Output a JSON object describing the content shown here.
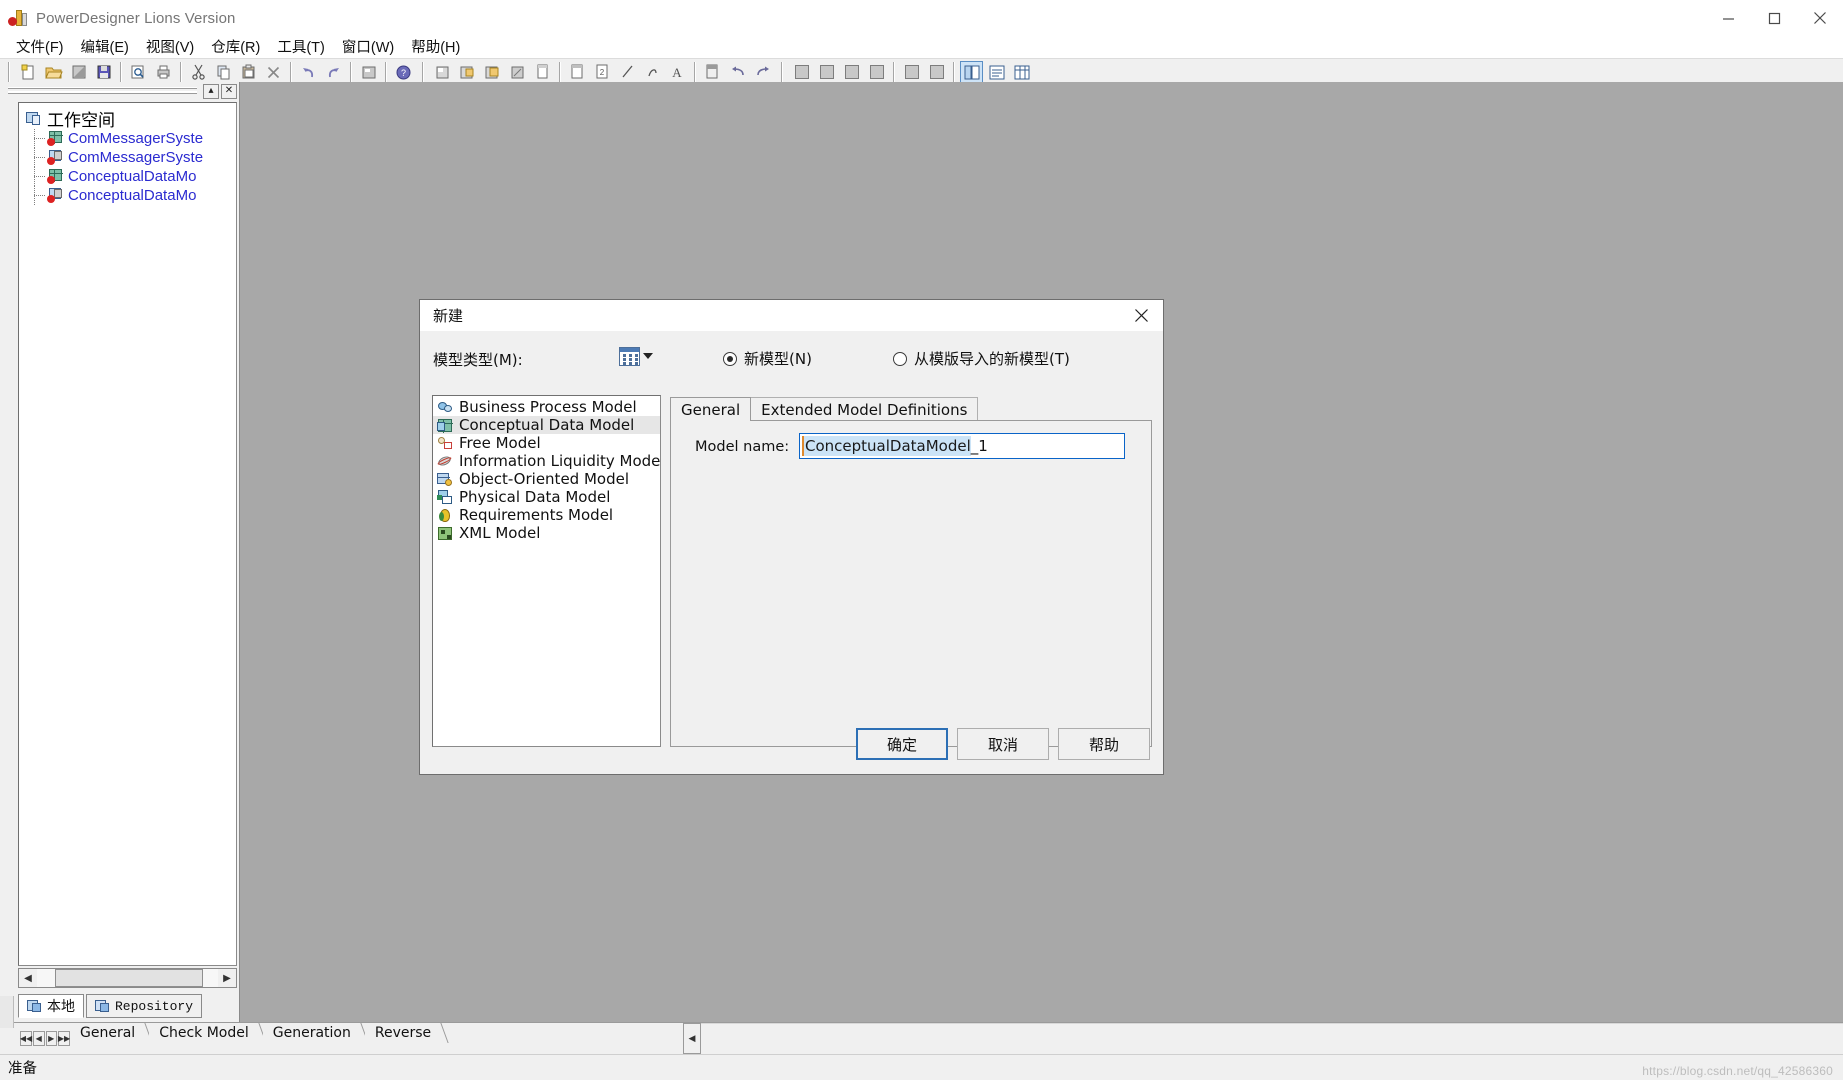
{
  "window": {
    "title": "PowerDesigner Lions Version",
    "app_icon": "powerdesigner-icon",
    "controls": {
      "minimize": "minimize-icon",
      "maximize": "maximize-icon",
      "close": "close-icon"
    }
  },
  "menubar": {
    "items": [
      {
        "label": "文件(F)",
        "name": "menu-file"
      },
      {
        "label": "编辑(E)",
        "name": "menu-edit"
      },
      {
        "label": "视图(V)",
        "name": "menu-view"
      },
      {
        "label": "仓库(R)",
        "name": "menu-repository"
      },
      {
        "label": "工具(T)",
        "name": "menu-tools"
      },
      {
        "label": "窗口(W)",
        "name": "menu-window"
      },
      {
        "label": "帮助(H)",
        "name": "menu-help"
      }
    ]
  },
  "toolbar": {
    "groups": [
      {
        "buttons": [
          "new-icon",
          "open-icon",
          "save-icon",
          "save-all-icon"
        ]
      },
      {
        "buttons": [
          "print-preview-icon",
          "print-icon"
        ]
      },
      {
        "buttons": [
          "cut-icon",
          "copy-icon",
          "paste-icon",
          "delete-icon"
        ]
      },
      {
        "buttons": [
          "undo-icon",
          "redo-icon"
        ]
      },
      {
        "buttons": [
          "properties-icon"
        ]
      },
      {
        "buttons": [
          "help-icon"
        ]
      },
      {
        "buttons": [
          "new-diagram-icon",
          "open-diagram-icon",
          "save-diagram-icon",
          "diagram-props-icon",
          "page-icon"
        ]
      },
      {
        "buttons": [
          "object-icon",
          "object2-icon",
          "line-icon",
          "link-icon",
          "text-icon"
        ]
      },
      {
        "buttons": [
          "note-icon",
          "arrow-left-icon",
          "arrow-right-icon"
        ]
      },
      {
        "buttons": [
          "zoom1-icon",
          "zoom2-icon",
          "zoom3-icon",
          "zoom4-icon"
        ]
      },
      {
        "buttons": [
          "view1-icon",
          "view2-icon"
        ]
      },
      {
        "buttons": [
          "browser-icon",
          "output-icon",
          "grid-view-icon"
        ]
      }
    ],
    "active_button": "browser-icon"
  },
  "left_panel": {
    "minimize_label": "▴",
    "close_label": "✕",
    "tree": {
      "root": {
        "label": "工作空间",
        "icon": "workspace-icon"
      },
      "nodes": [
        {
          "label": "ComMessagerSyste",
          "icon": "cdm-model-icon"
        },
        {
          "label": "ComMessagerSyste",
          "icon": "pdm-model-icon"
        },
        {
          "label": "ConceptualDataMo",
          "icon": "cdm-model-icon"
        },
        {
          "label": "ConceptualDataMo",
          "icon": "pdm-model-icon"
        }
      ]
    },
    "tabs": [
      {
        "label": "本地",
        "icon": "local-icon",
        "selected": true
      },
      {
        "label": "Repository",
        "icon": "repository-icon",
        "selected": false
      }
    ],
    "scroll_left": "◀",
    "scroll_right": "▶"
  },
  "dialog": {
    "title": "新建",
    "close_label": "✕",
    "model_type_label": "模型类型(M):",
    "view_button_icon": "list-view-icon",
    "view_button_caret": "chevron-down-icon",
    "radios": [
      {
        "label": "新模型(N)",
        "selected": true,
        "name": "radio-new-model"
      },
      {
        "label": "从模版导入的新模型(T)",
        "selected": false,
        "name": "radio-from-template"
      }
    ],
    "model_types": [
      {
        "label": "Business Process Model",
        "icon": "bpm-icon",
        "selected": false
      },
      {
        "label": "Conceptual Data Model",
        "icon": "cdm-icon",
        "selected": true
      },
      {
        "label": "Free Model",
        "icon": "free-model-icon",
        "selected": false
      },
      {
        "label": "Information Liquidity Model",
        "icon": "ilm-icon",
        "selected": false
      },
      {
        "label": "Object-Oriented Model",
        "icon": "oom-icon",
        "selected": false
      },
      {
        "label": "Physical Data Model",
        "icon": "pdm-icon",
        "selected": false
      },
      {
        "label": "Requirements Model",
        "icon": "requirements-icon",
        "selected": false
      },
      {
        "label": "XML Model",
        "icon": "xml-icon",
        "selected": false
      }
    ],
    "tabs": [
      {
        "label": "General",
        "selected": true
      },
      {
        "label": "Extended Model Definitions",
        "selected": false
      }
    ],
    "model_name_label": "Model name:",
    "model_name_value_selected": "ConceptualDataModel",
    "model_name_value_rest": "_1",
    "buttons": [
      {
        "label": "确定",
        "name": "ok-button",
        "primary": true
      },
      {
        "label": "取消",
        "name": "cancel-button",
        "primary": false
      },
      {
        "label": "帮助",
        "name": "help-button",
        "primary": false
      }
    ]
  },
  "bottom": {
    "nav_buttons": [
      "◀◀",
      "◀",
      "▶",
      "▶▶"
    ],
    "tabs": [
      {
        "label": "General"
      },
      {
        "label": "Check Model"
      },
      {
        "label": "Generation"
      },
      {
        "label": "Reverse"
      }
    ],
    "scroll_left": "◀",
    "scroll_right": "▶"
  },
  "statusbar": {
    "text": "准备",
    "watermark": "https://blog.csdn.net/qq_42586360"
  },
  "colors": {
    "accent": "#2c6fb5",
    "selection": "#cce4f7",
    "tree_text": "#2b2bd0",
    "canvas": "#a8a8a8",
    "chrome": "#f0f0f0"
  }
}
